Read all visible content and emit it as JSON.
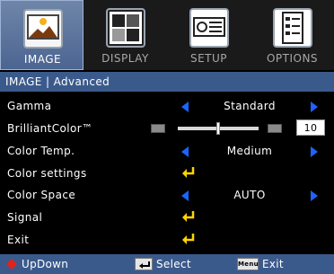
{
  "tabs": [
    {
      "label": "IMAGE",
      "icon": "image-icon",
      "active": true
    },
    {
      "label": "DISPLAY",
      "icon": "display-icon",
      "active": false
    },
    {
      "label": "SETUP",
      "icon": "projector-icon",
      "active": false
    },
    {
      "label": "OPTIONS",
      "icon": "options-icon",
      "active": false
    }
  ],
  "breadcrumb": "IMAGE  |  Advanced",
  "rows": {
    "gamma": {
      "label": "Gamma",
      "value": "Standard"
    },
    "brilliant": {
      "label": "BrilliantColor™",
      "value": "10",
      "level": 0.5
    },
    "color_temp": {
      "label": "Color Temp.",
      "value": "Medium"
    },
    "color_settings": {
      "label": "Color settings"
    },
    "color_space": {
      "label": "Color Space",
      "value": "AUTO"
    },
    "signal": {
      "label": "Signal"
    },
    "exit": {
      "label": "Exit"
    }
  },
  "footer": {
    "updown": "UpDown",
    "select": "Select",
    "menu_key": "Menu",
    "exit": "Exit"
  },
  "colors": {
    "accent_blue": "#1c63ff",
    "bar_blue": "#3b5a8c",
    "tab_active": "#5b74a0",
    "enter_yellow": "#ffd400",
    "updown_red": "#e2231a"
  }
}
